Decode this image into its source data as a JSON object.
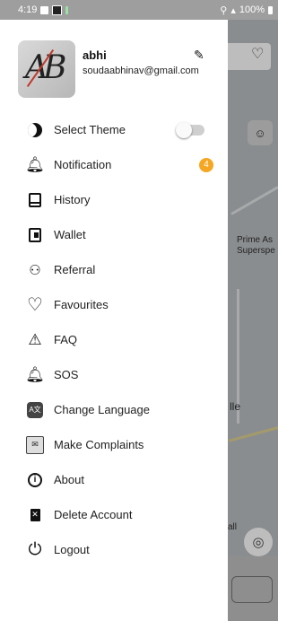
{
  "status_bar": {
    "time": "4:19",
    "battery": "100%"
  },
  "profile": {
    "name": "abhi",
    "email": "soudaabhinav@gmail.com",
    "avatar_monogram": "AB"
  },
  "menu": [
    {
      "label": "Select Theme",
      "icon": "moon-icon"
    },
    {
      "label": "Notification",
      "icon": "bell-icon",
      "badge": "4"
    },
    {
      "label": "History",
      "icon": "history-icon"
    },
    {
      "label": "Wallet",
      "icon": "wallet-icon"
    },
    {
      "label": "Referral",
      "icon": "referral-icon"
    },
    {
      "label": "Favourites",
      "icon": "heart-icon"
    },
    {
      "label": "FAQ",
      "icon": "warning-icon"
    },
    {
      "label": "SOS",
      "icon": "bell-outline-icon"
    },
    {
      "label": "Change Language",
      "icon": "language-icon"
    },
    {
      "label": "Make Complaints",
      "icon": "complaint-icon"
    },
    {
      "label": "About",
      "icon": "info-icon"
    },
    {
      "label": "Delete Account",
      "icon": "trash-icon"
    },
    {
      "label": "Logout",
      "icon": "power-icon"
    }
  ],
  "theme_toggle": {
    "on": false
  },
  "map_labels": {
    "place_1": "Prime As",
    "place_2": "Superspe",
    "place_3": "lle",
    "place_4": "all"
  },
  "colors": {
    "badge": "#f5a623",
    "overlay": "#8a8d8f"
  }
}
